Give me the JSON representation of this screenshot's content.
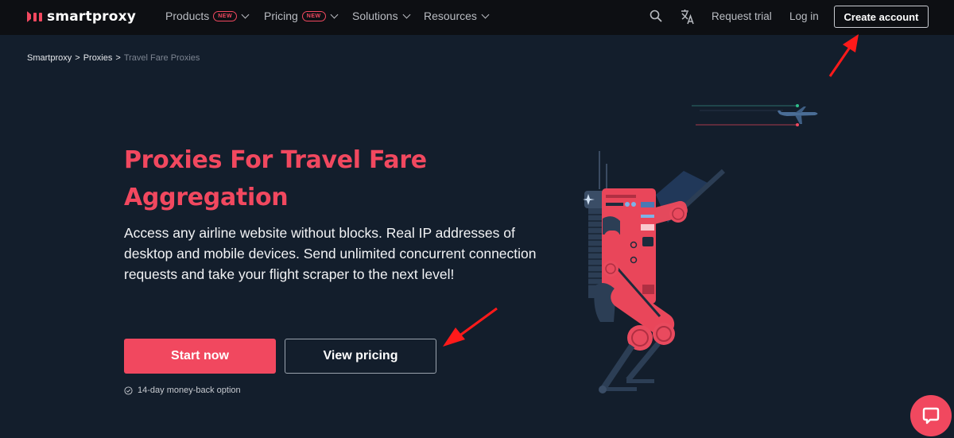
{
  "nav": {
    "brand": "smartproxy",
    "items": [
      {
        "label": "Products",
        "badge": "NEW"
      },
      {
        "label": "Pricing",
        "badge": "NEW"
      },
      {
        "label": "Solutions"
      },
      {
        "label": "Resources"
      }
    ],
    "search_icon": "search-icon",
    "language_icon": "translate-icon",
    "request_trial": "Request trial",
    "login": "Log in",
    "create_account": "Create account"
  },
  "breadcrumb": {
    "items": [
      "Smartproxy",
      "Proxies",
      "Travel Fare Proxies"
    ],
    "separator": ">"
  },
  "hero": {
    "title": "Proxies For Travel Fare Aggregation",
    "description": "Access any airline website without blocks. Real IP addresses of desktop and mobile devices. Send unlimited concurrent connection requests and take your flight scraper to the next level!",
    "primary_cta": "Start now",
    "secondary_cta": "View pricing",
    "guarantee": "14-day money-back option"
  },
  "chat": {
    "icon": "chat-icon"
  },
  "colors": {
    "accent": "#f1485f",
    "background": "#131e2c",
    "nav_background": "#0d0f13",
    "annotation_arrow": "#ff1a1a"
  }
}
